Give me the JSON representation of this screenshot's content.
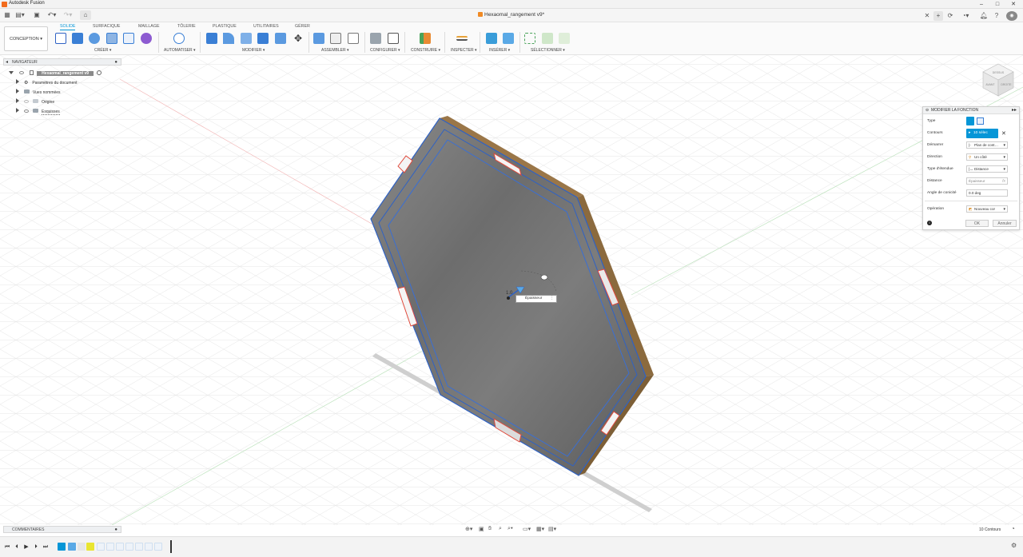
{
  "app": {
    "title": "Autodesk Fusion"
  },
  "window": {
    "minimize": "–",
    "maximize": "□",
    "close": "✕"
  },
  "document": {
    "title": "Hexaomal_rangement v9*"
  },
  "ribbon": {
    "workspace": "CONCEPTION ▾",
    "tabs": [
      "SOLIDE",
      "SURFACIQUE",
      "MAILLAGE",
      "TÔLERIE",
      "PLASTIQUE",
      "UTILITAIRES",
      "GÉRER"
    ],
    "active_tab": "SOLIDE",
    "groups": [
      "CRÉER ▾",
      "AUTOMATISER ▾",
      "MODIFIER ▾",
      "ASSEMBLER ▾",
      "CONFIGURER ▾",
      "CONSTRUIRE ▾",
      "INSPECTER ▾",
      "INSÉRER ▾",
      "SÉLECTIONNER ▾"
    ]
  },
  "navigator": {
    "title": "NAVIGATEUR",
    "root": "Hexaomal_rangement v9",
    "items": [
      "Paramètres du document",
      "Vues nommées",
      "Origine",
      "Esquisses"
    ]
  },
  "panel": {
    "title": "MODIFIER LA FONCTION",
    "rows": [
      {
        "label": "Type",
        "value": ""
      },
      {
        "label": "Contours",
        "value": "10 sélec"
      },
      {
        "label": "Démarrer",
        "value": "Plan de cont…"
      },
      {
        "label": "Direction",
        "value": "Un côté"
      },
      {
        "label": "Type d'étendue",
        "value": "Distance"
      },
      {
        "label": "Distance",
        "value": "Épaisseur"
      },
      {
        "label": "Angle de conicité",
        "value": "0.0 deg"
      },
      {
        "label": "Opération",
        "value": "Nouveau cor"
      }
    ],
    "ok": "OK",
    "cancel": "Annuler"
  },
  "viewport": {
    "dimension_tag": "Épaisseur",
    "dimension_value": "1.0"
  },
  "comments": {
    "title": "COMMENTAIRES"
  },
  "status": {
    "text": "10 Contours"
  },
  "viewcube": {
    "face_top": "DESSUS",
    "face_front": "AVANT",
    "face_right": "DROITE"
  },
  "colors": {
    "accent": "#0696d7",
    "panel_selection": "#0696d7",
    "plate": "#707070",
    "edge": "#2f62c4",
    "wood": "#8b6a3e",
    "notch": "#e04a3c"
  }
}
